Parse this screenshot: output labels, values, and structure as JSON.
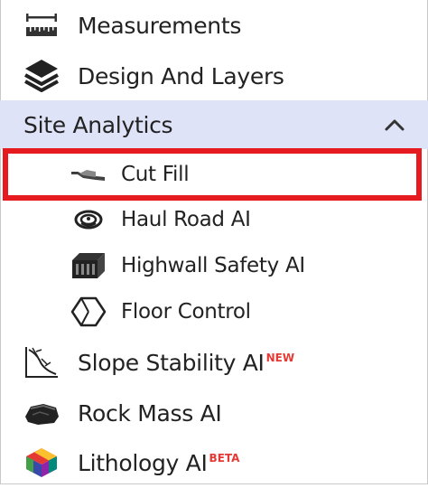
{
  "menu": {
    "measurements": {
      "label": "Measurements",
      "icon": "ruler-icon"
    },
    "design_layers": {
      "label": "Design And Layers",
      "icon": "layers-icon"
    },
    "site_analytics": {
      "label": "Site Analytics",
      "expanded": true,
      "header_bg": "#dfe3f8",
      "children": [
        {
          "label": "Cut Fill",
          "icon": "cut-fill-icon",
          "highlighted": true
        },
        {
          "label": "Haul Road AI",
          "icon": "haul-road-icon"
        },
        {
          "label": "Highwall Safety AI",
          "icon": "highwall-icon"
        },
        {
          "label": "Floor Control",
          "icon": "floor-control-icon"
        }
      ]
    },
    "slope_stability": {
      "label": "Slope Stability AI",
      "badge": "NEW",
      "icon": "slope-icon"
    },
    "rock_mass": {
      "label": "Rock Mass AI",
      "icon": "rock-icon"
    },
    "lithology": {
      "label": "Lithology AI",
      "badge": "BETA",
      "icon": "lithology-icon"
    }
  },
  "colors": {
    "highlight_border": "#e51b1f",
    "badge": "#e53935",
    "text": "#222222"
  }
}
